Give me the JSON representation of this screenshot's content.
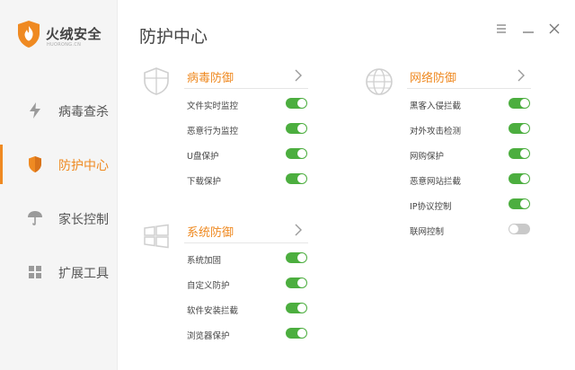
{
  "app": {
    "brand_name": "火绒安全",
    "brand_url": "HUORONG.CN",
    "accent_color": "#ef8a22",
    "toggle_on_color": "#4cae3f",
    "toggle_off_color": "#c9c9c9"
  },
  "sidebar": {
    "items": [
      {
        "label": "病毒查杀",
        "icon": "lightning-icon",
        "active": false
      },
      {
        "label": "防护中心",
        "icon": "shield-icon",
        "active": true
      },
      {
        "label": "家长控制",
        "icon": "umbrella-icon",
        "active": false
      },
      {
        "label": "扩展工具",
        "icon": "grid-icon",
        "active": false
      }
    ]
  },
  "header": {
    "title": "防护中心",
    "controls": [
      "menu-icon",
      "minimize-icon",
      "close-icon"
    ]
  },
  "sections": {
    "virus": {
      "title": "病毒防御",
      "icon": "shield-outline-icon",
      "items": [
        {
          "label": "文件实时监控",
          "on": true
        },
        {
          "label": "恶意行为监控",
          "on": true
        },
        {
          "label": "U盘保护",
          "on": true
        },
        {
          "label": "下载保护",
          "on": true
        }
      ]
    },
    "system": {
      "title": "系统防御",
      "icon": "windows-icon",
      "items": [
        {
          "label": "系统加固",
          "on": true
        },
        {
          "label": "自定义防护",
          "on": true
        },
        {
          "label": "软件安装拦截",
          "on": true
        },
        {
          "label": "浏览器保护",
          "on": true
        }
      ]
    },
    "network": {
      "title": "网络防御",
      "icon": "globe-icon",
      "items": [
        {
          "label": "黑客入侵拦截",
          "on": true
        },
        {
          "label": "对外攻击检测",
          "on": true
        },
        {
          "label": "网购保护",
          "on": true
        },
        {
          "label": "恶意网站拦截",
          "on": true
        },
        {
          "label": "IP协议控制",
          "on": true
        },
        {
          "label": "联网控制",
          "on": false
        }
      ]
    }
  }
}
